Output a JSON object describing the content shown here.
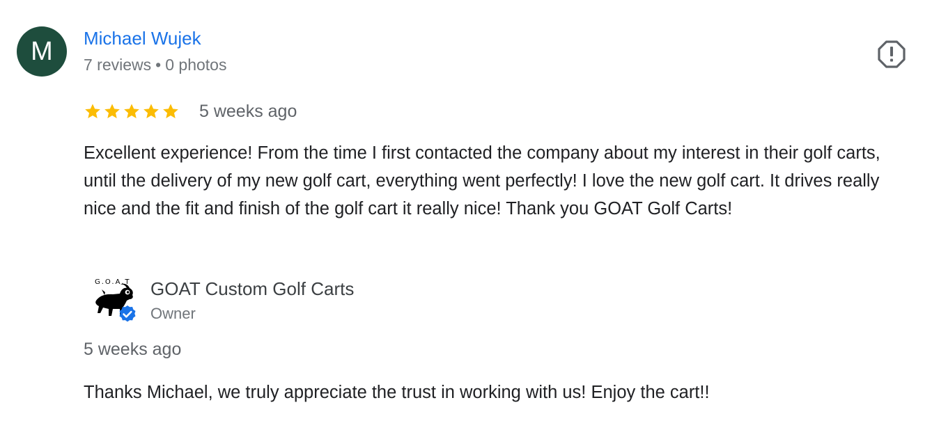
{
  "reviewer": {
    "avatar_letter": "M",
    "name": "Michael Wujek",
    "reviews_count": "7 reviews",
    "separator": "•",
    "photos_count": "0 photos"
  },
  "review": {
    "rating": 5,
    "max_rating": 5,
    "date": "5 weeks ago",
    "text": "Excellent experience! From the time I first contacted the company about my interest in their golf carts, until the delivery of my new golf cart, everything went perfectly! I love the new golf cart. It drives really nice and the fit and finish of the golf cart it really nice! Thank you GOAT Golf Carts!"
  },
  "owner_response": {
    "name": "GOAT Custom Golf Carts",
    "role": "Owner",
    "date": "5 weeks ago",
    "text": "Thanks Michael, we truly appreciate the trust in working with us! Enjoy the cart!!",
    "logo_text": "G.O.A.T"
  },
  "icons": {
    "report": "report-flag-icon",
    "star": "star-icon",
    "verified": "verified-badge-icon"
  },
  "colors": {
    "avatar_bg": "#1e4d3d",
    "name_link": "#1a73e8",
    "star": "#fbbc04",
    "verified": "#1a73e8"
  }
}
